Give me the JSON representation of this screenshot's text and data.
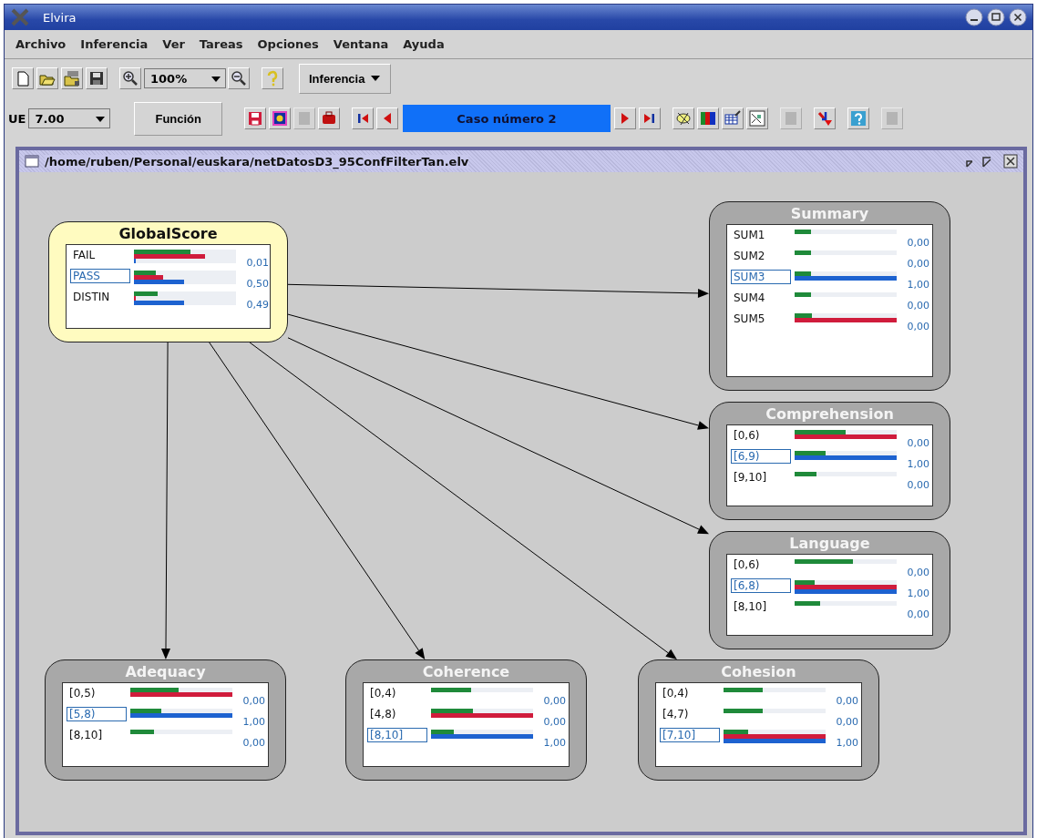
{
  "window": {
    "title": "Elvira"
  },
  "menu": [
    "Archivo",
    "Inferencia",
    "Ver",
    "Tareas",
    "Opciones",
    "Ventana",
    "Ayuda"
  ],
  "toolbar": [
    {
      "kind": "new",
      "disabled": false
    },
    {
      "kind": "open",
      "disabled": false
    },
    {
      "kind": "opendb",
      "disabled": false
    },
    {
      "kind": "save",
      "disabled": false
    },
    {
      "kind": "zoomin",
      "disabled": false
    },
    {
      "kind": "combo",
      "value": "100%"
    },
    {
      "kind": "zoomout",
      "disabled": false
    },
    {
      "kind": "help",
      "disabled": false
    },
    {
      "kind": "menubutton",
      "label": "Inferencia"
    }
  ],
  "case_toolbar": [
    {
      "kind": "label",
      "label": "UE"
    },
    {
      "kind": "combo",
      "value": "7.00"
    },
    {
      "kind": "textbutton",
      "label": "Función"
    },
    {
      "kind": "savecase",
      "disabled": false
    },
    {
      "kind": "target",
      "disabled": false
    },
    {
      "kind": "blank",
      "disabled": true
    },
    {
      "kind": "toolbox",
      "disabled": false
    },
    {
      "kind": "first",
      "disabled": false
    },
    {
      "kind": "prev",
      "disabled": false
    },
    {
      "kind": "case",
      "value": "Caso número 2"
    },
    {
      "kind": "next",
      "disabled": false
    },
    {
      "kind": "last",
      "disabled": false
    },
    {
      "kind": "ellipse",
      "disabled": false
    },
    {
      "kind": "colors",
      "disabled": false
    },
    {
      "kind": "table",
      "disabled": false
    },
    {
      "kind": "chart",
      "disabled": false
    },
    {
      "kind": "blank",
      "disabled": true
    },
    {
      "kind": "arrow",
      "disabled": false
    },
    {
      "kind": "question",
      "disabled": false
    },
    {
      "kind": "blank",
      "disabled": true
    }
  ],
  "frame": {
    "title": "/home/ruben/Personal/euskara/netDatosD3_95ConfFilterTan.elv"
  },
  "nodes": [
    {
      "title": "GlobalScore",
      "observed": false,
      "states": [
        {
          "label": "FAIL",
          "selected": false,
          "value": "0,01",
          "bars": [
            {
              "color": "#1f8a3a",
              "level": 0.55
            },
            {
              "color": "#d01c3c",
              "level": 0.7
            },
            {
              "color": "#1d62d0",
              "level": 0.02
            }
          ]
        },
        {
          "label": "PASS",
          "selected": true,
          "value": "0,50",
          "bars": [
            {
              "color": "#1f8a3a",
              "level": 0.21
            },
            {
              "color": "#d01c3c",
              "level": 0.29
            },
            {
              "color": "#1d62d0",
              "level": 0.49
            }
          ]
        },
        {
          "label": "DISTIN",
          "selected": false,
          "value": "0,49",
          "bars": [
            {
              "color": "#1f8a3a",
              "level": 0.23
            },
            {
              "color": "#d01c3c",
              "level": 0.02
            },
            {
              "color": "#1d62d0",
              "level": 0.49
            }
          ]
        }
      ]
    },
    {
      "title": "Summary",
      "observed": true,
      "states": [
        {
          "label": "SUM1",
          "selected": false,
          "value": "0,00",
          "bars": [
            {
              "color": "#1f8a3a",
              "level": 0.16
            }
          ]
        },
        {
          "label": "SUM2",
          "selected": false,
          "value": "0,00",
          "bars": [
            {
              "color": "#1f8a3a",
              "level": 0.16
            }
          ]
        },
        {
          "label": "SUM3",
          "selected": true,
          "value": "1,00",
          "bars": [
            {
              "color": "#1f8a3a",
              "level": 0.16
            },
            {
              "color": "#1d62d0",
              "level": 1
            }
          ]
        },
        {
          "label": "SUM4",
          "selected": false,
          "value": "0,00",
          "bars": [
            {
              "color": "#1f8a3a",
              "level": 0.16
            }
          ]
        },
        {
          "label": "SUM5",
          "selected": false,
          "value": "0,00",
          "bars": [
            {
              "color": "#1f8a3a",
              "level": 0.17
            },
            {
              "color": "#d01c3c",
              "level": 1
            }
          ]
        }
      ]
    },
    {
      "title": "Comprehension",
      "observed": true,
      "states": [
        {
          "label": "[0,6)",
          "selected": false,
          "value": "0,00",
          "bars": [
            {
              "color": "#1f8a3a",
              "level": 0.5
            },
            {
              "color": "#d01c3c",
              "level": 1
            }
          ]
        },
        {
          "label": "[6,9)",
          "selected": true,
          "value": "1,00",
          "bars": [
            {
              "color": "#1f8a3a",
              "level": 0.3
            },
            {
              "color": "#1d62d0",
              "level": 1
            }
          ]
        },
        {
          "label": "[9,10]",
          "selected": false,
          "value": "0,00",
          "bars": [
            {
              "color": "#1f8a3a",
              "level": 0.21
            }
          ]
        }
      ]
    },
    {
      "title": "Language",
      "observed": true,
      "states": [
        {
          "label": "[0,6)",
          "selected": false,
          "value": "0,00",
          "bars": [
            {
              "color": "#1f8a3a",
              "level": 0.57
            }
          ]
        },
        {
          "label": "[6,8)",
          "selected": true,
          "value": "1,00",
          "bars": [
            {
              "color": "#1f8a3a",
              "level": 0.2
            },
            {
              "color": "#d01c3c",
              "level": 1
            },
            {
              "color": "#1d62d0",
              "level": 1
            }
          ]
        },
        {
          "label": "[8,10]",
          "selected": false,
          "value": "0,00",
          "bars": [
            {
              "color": "#1f8a3a",
              "level": 0.25
            }
          ]
        }
      ]
    },
    {
      "title": "Adequacy",
      "observed": true,
      "states": [
        {
          "label": "[0,5)",
          "selected": false,
          "value": "0,00",
          "bars": [
            {
              "color": "#1f8a3a",
              "level": 0.47
            },
            {
              "color": "#d01c3c",
              "level": 1
            }
          ]
        },
        {
          "label": "[5,8)",
          "selected": true,
          "value": "1,00",
          "bars": [
            {
              "color": "#1f8a3a",
              "level": 0.3
            },
            {
              "color": "#1d62d0",
              "level": 1
            }
          ]
        },
        {
          "label": "[8,10]",
          "selected": false,
          "value": "0,00",
          "bars": [
            {
              "color": "#1f8a3a",
              "level": 0.23
            }
          ]
        }
      ]
    },
    {
      "title": "Coherence",
      "observed": true,
      "states": [
        {
          "label": "[0,4)",
          "selected": false,
          "value": "0,00",
          "bars": [
            {
              "color": "#1f8a3a",
              "level": 0.39
            }
          ]
        },
        {
          "label": "[4,8)",
          "selected": false,
          "value": "0,00",
          "bars": [
            {
              "color": "#1f8a3a",
              "level": 0.41
            },
            {
              "color": "#d01c3c",
              "level": 1
            }
          ]
        },
        {
          "label": "[8,10]",
          "selected": true,
          "value": "1,00",
          "bars": [
            {
              "color": "#1f8a3a",
              "level": 0.22
            },
            {
              "color": "#1d62d0",
              "level": 1
            }
          ]
        }
      ]
    },
    {
      "title": "Cohesion",
      "observed": true,
      "states": [
        {
          "label": "[0,4)",
          "selected": false,
          "value": "0,00",
          "bars": [
            {
              "color": "#1f8a3a",
              "level": 0.38
            }
          ]
        },
        {
          "label": "[4,7)",
          "selected": false,
          "value": "0,00",
          "bars": [
            {
              "color": "#1f8a3a",
              "level": 0.38
            }
          ]
        },
        {
          "label": "[7,10]",
          "selected": true,
          "value": "1,00",
          "bars": [
            {
              "color": "#1f8a3a",
              "level": 0.24
            },
            {
              "color": "#d01c3c",
              "level": 1
            },
            {
              "color": "#1d62d0",
              "level": 1
            }
          ]
        }
      ]
    }
  ]
}
